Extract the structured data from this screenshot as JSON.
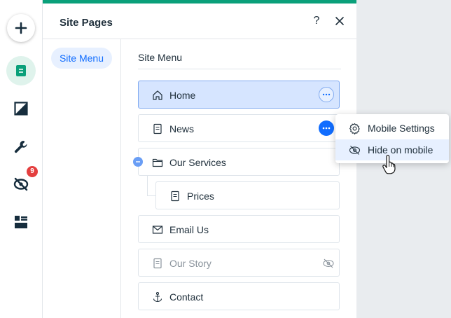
{
  "toolbar": {
    "items": [
      "add-elements",
      "pages",
      "design",
      "tools",
      "hidden-elements",
      "apps"
    ],
    "hidden_badge": "9"
  },
  "panel": {
    "title": "Site Pages",
    "help": "?",
    "nav_item": "Site Menu",
    "content_title": "Site Menu",
    "accent_color": "#0aa07a"
  },
  "pages": [
    {
      "label": "Home",
      "icon": "home-icon",
      "selected": true
    },
    {
      "label": "News",
      "icon": "page-icon"
    },
    {
      "label": "Our Services",
      "icon": "folder-icon"
    },
    {
      "label": "Prices",
      "icon": "page-icon",
      "indent": 1
    },
    {
      "label": "Email Us",
      "icon": "mail-icon"
    },
    {
      "label": "Our Story",
      "icon": "page-icon",
      "hidden": true
    },
    {
      "label": "Contact",
      "icon": "anchor-icon"
    }
  ],
  "context_menu": {
    "items": [
      {
        "label": "Mobile Settings",
        "icon": "gear-icon"
      },
      {
        "label": "Hide on mobile",
        "icon": "eye-hidden-icon",
        "hover": true
      }
    ]
  },
  "colors": {
    "primary": "#116dff",
    "selected_bg": "#d6e5ff",
    "text": "#20303c",
    "badge": "#e43f3f"
  }
}
